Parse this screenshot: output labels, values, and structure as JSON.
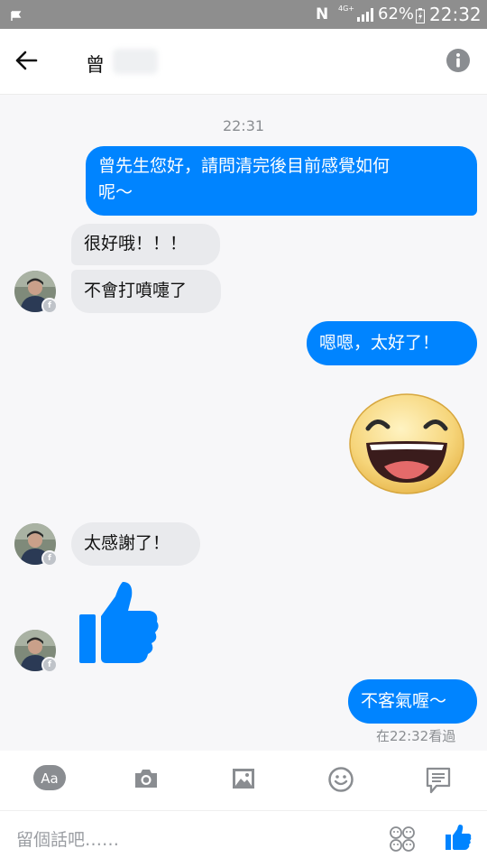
{
  "status_bar": {
    "network": "4G+",
    "battery": "62%",
    "time": "22:32"
  },
  "header": {
    "contact_name": "曾"
  },
  "conversation": {
    "timestamp": "22:31",
    "messages": [
      {
        "from": "me",
        "type": "text",
        "lines": [
          "曾先生您好，請問清完後目前感覺如何",
          "呢～"
        ]
      },
      {
        "from": "contact",
        "type": "text",
        "text": "很好哦！！！"
      },
      {
        "from": "contact",
        "type": "text",
        "text": "不會打噴嚏了"
      },
      {
        "from": "me",
        "type": "text",
        "text": "嗯嗯，太好了！"
      },
      {
        "from": "me",
        "type": "sticker",
        "icon": "grinning-face-sticker"
      },
      {
        "from": "contact",
        "type": "text",
        "text": "太感謝了！"
      },
      {
        "from": "contact",
        "type": "sticker",
        "icon": "thumbs-up-sticker"
      },
      {
        "from": "me",
        "type": "text",
        "text": "不客氣喔～"
      }
    ],
    "seen_receipt": "在22:32看過"
  },
  "composer": {
    "text_style_label": "Aa",
    "placeholder": "留個話吧……",
    "toolbar_icons": [
      "text-style-icon",
      "camera-icon",
      "image-icon",
      "emoji-icon",
      "chat-bubble-icon"
    ],
    "input_icons": [
      "stickers-icon",
      "thumbs-up-icon"
    ]
  },
  "colors": {
    "outgoing_bubble": "#0084ff",
    "incoming_bubble": "#e9eaed",
    "accent": "#0084ff",
    "status_bar": "#8e8e8e"
  }
}
